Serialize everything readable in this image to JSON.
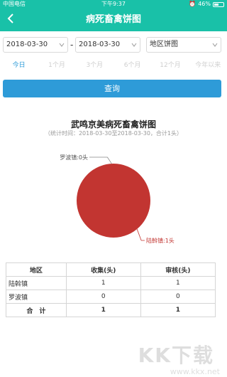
{
  "status_bar": {
    "carrier": "中国电信",
    "time": "下午9:37",
    "battery_text": "46%",
    "battery_level": 0.46
  },
  "header": {
    "title": "病死畜禽饼图"
  },
  "filters": {
    "start_date": "2018-03-30",
    "separator": "-",
    "end_date": "2018-03-30",
    "chart_type": "地区饼图"
  },
  "tabs": [
    {
      "label": "今日",
      "active": true
    },
    {
      "label": "1个月",
      "active": false
    },
    {
      "label": "3个月",
      "active": false
    },
    {
      "label": "6个月",
      "active": false
    },
    {
      "label": "12个月",
      "active": false
    },
    {
      "label": "今年以来",
      "active": false
    }
  ],
  "query_button": "查询",
  "chart_data": {
    "type": "pie",
    "title": "武鸣京美病死畜禽饼图",
    "subtitle": "（统计时间：2018-03-30至2018-03-30，合计1头）",
    "slices": [
      {
        "label": "罗波镇:0头",
        "value": 0,
        "color": "#c23531"
      },
      {
        "label": "陆斡镇:1头",
        "value": 1,
        "color": "#c23531"
      }
    ]
  },
  "table": {
    "headers": [
      "地区",
      "收集(头)",
      "审核(头)"
    ],
    "rows": [
      [
        "陆斡镇",
        "1",
        "1"
      ],
      [
        "罗波镇",
        "0",
        "0"
      ]
    ],
    "total": [
      "合　计",
      "1",
      "1"
    ]
  },
  "watermark": {
    "big": "KK下载",
    "small": "www.kkx.net"
  },
  "colors": {
    "header": "#19c1a8",
    "accent": "#2e9bd8",
    "pie": "#c23531"
  }
}
